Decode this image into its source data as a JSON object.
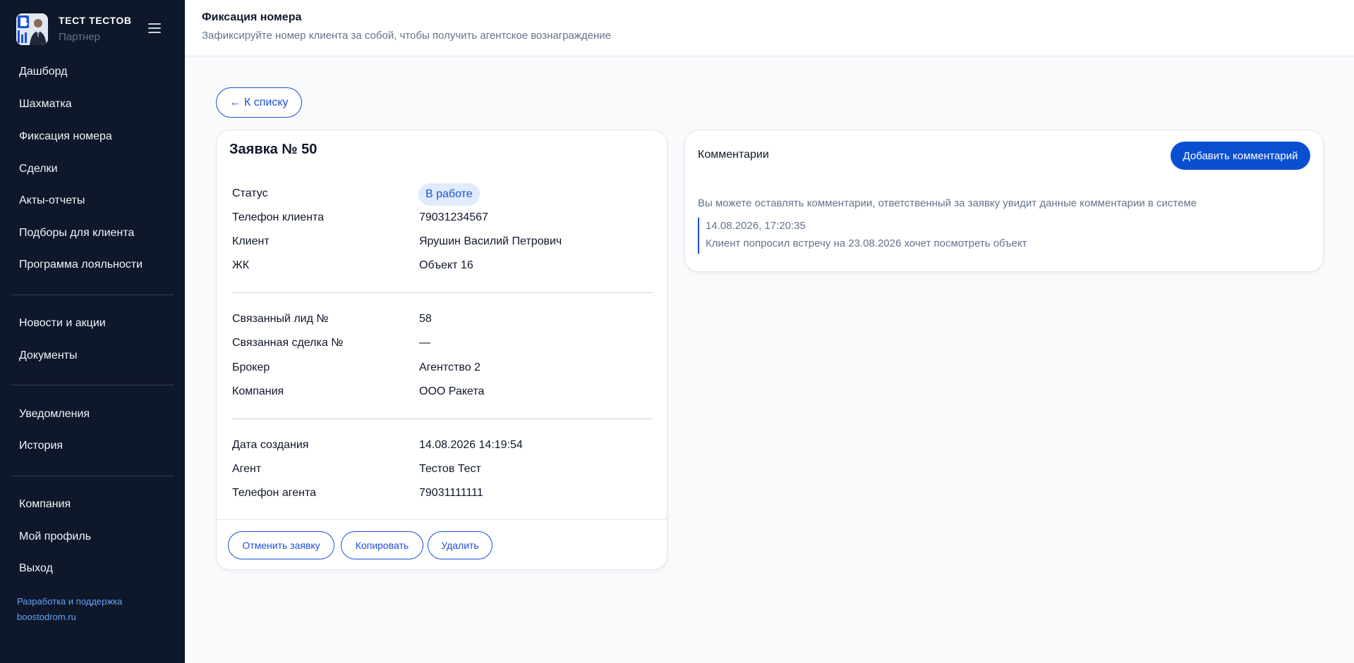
{
  "brand": {
    "name": "ТЕСТ ТЕСТОВ",
    "role": "Партнер"
  },
  "sidebar": {
    "items": [
      {
        "label": "Дашборд"
      },
      {
        "label": "Шахматка"
      },
      {
        "label": "Фиксация номера"
      },
      {
        "label": "Сделки"
      },
      {
        "label": "Акты-отчеты"
      },
      {
        "label": "Подборы для клиента"
      },
      {
        "label": "Программа лояльности"
      },
      {
        "label": "Новости и акции"
      },
      {
        "label": "Документы"
      },
      {
        "label": "Уведомления"
      },
      {
        "label": "История"
      },
      {
        "label": "Компания"
      },
      {
        "label": "Мой профиль"
      },
      {
        "label": "Выход"
      }
    ],
    "dev_line1": "Разработка и поддержка",
    "dev_line2": "boostodrom.ru"
  },
  "header": {
    "title": "Фиксация номера",
    "subtitle": "Зафиксируйте номер клиента за собой, чтобы получить агентское вознаграждение"
  },
  "back_label": "← К списку",
  "request": {
    "title": "Заявка № 50",
    "status_label": "Статус",
    "status_value": "В работе",
    "fields": [
      {
        "label": "Телефон клиента",
        "value": "79031234567"
      },
      {
        "label": "Клиент",
        "value": "Ярушин Василий Петрович"
      },
      {
        "label": "ЖК",
        "value": "Объект 16"
      },
      {
        "label": "Связанный лид №",
        "value": "58"
      },
      {
        "label": "Связанная сделка №",
        "value": "—"
      },
      {
        "label": "Брокер",
        "value": "Агентство 2"
      },
      {
        "label": "Компания",
        "value": "ООО Ракета"
      },
      {
        "label": "Дата создания",
        "value": "14.08.2026 14:19:54"
      },
      {
        "label": "Агент",
        "value": "Тестов Тест"
      },
      {
        "label": "Телефон агента",
        "value": "79031111111"
      }
    ],
    "actions": {
      "cancel": "Отменить заявку",
      "copy": "Копировать",
      "delete": "Удалить"
    }
  },
  "comments": {
    "title": "Комментарии",
    "add_label": "Добавить комментарий",
    "hint": "Вы можете оставлять комментарии, ответственный за заявку увидит данные комментарии в системе",
    "entries": [
      {
        "date": "14.08.2026, 17:20:35",
        "text": "Клиент попросил встречу на 23.08.2026 хочет посмотреть объект"
      }
    ]
  },
  "colors": {
    "sidebar_bg": "#0f172a",
    "accent": "#1d4ed8",
    "primary_button": "#0b4fd1",
    "badge_bg": "#e0ecfd"
  }
}
